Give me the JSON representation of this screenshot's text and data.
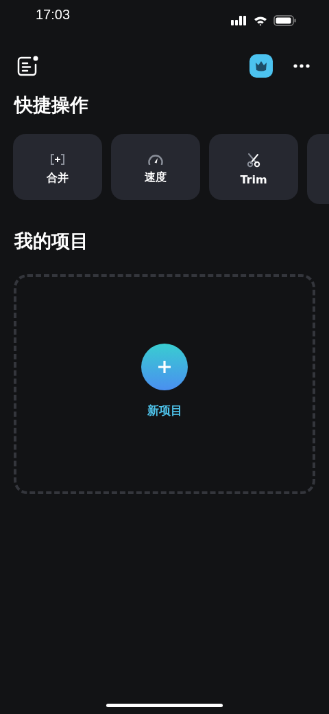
{
  "status_bar": {
    "time": "17:03"
  },
  "quick_actions": {
    "title": "快捷操作",
    "items": [
      {
        "kind": "merge",
        "label": "合并"
      },
      {
        "kind": "speed",
        "label": "速度"
      },
      {
        "kind": "trim",
        "label": "Trim"
      }
    ]
  },
  "projects": {
    "title": "我的项目",
    "new_project": {
      "label": "新项目"
    }
  }
}
